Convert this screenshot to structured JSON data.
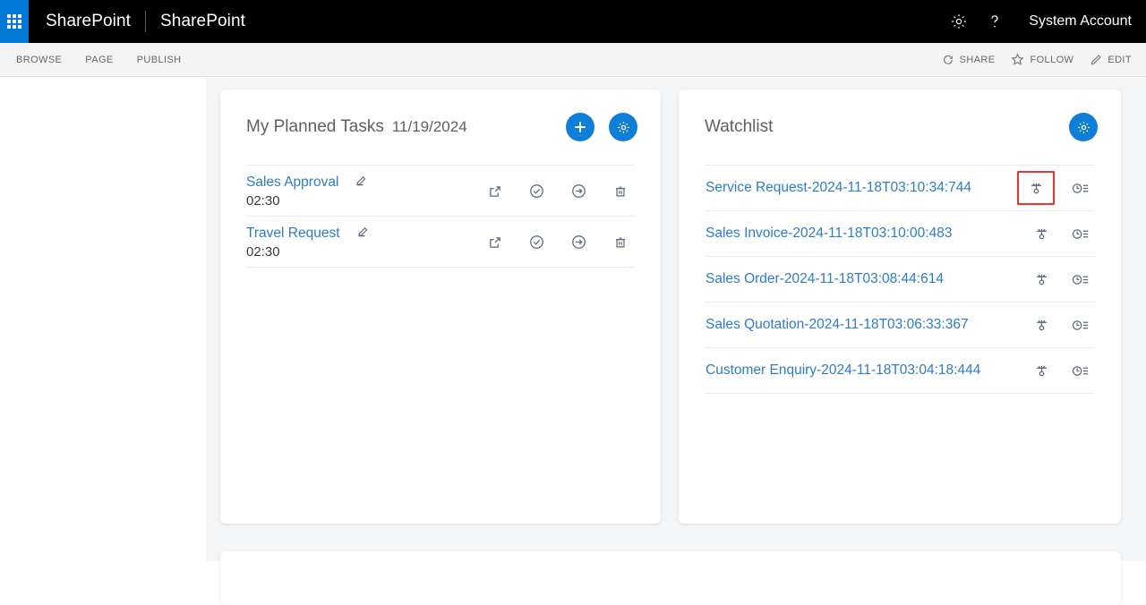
{
  "suite": {
    "app_launcher": "app-launcher",
    "brand": "SharePoint",
    "site": "SharePoint",
    "settings_icon": "gear-icon",
    "help_icon": "help-icon",
    "user": "System Account"
  },
  "ribbon": {
    "tabs": [
      {
        "label": "BROWSE"
      },
      {
        "label": "PAGE"
      },
      {
        "label": "PUBLISH"
      }
    ],
    "actions": [
      {
        "label": "SHARE",
        "icon": "share-icon"
      },
      {
        "label": "FOLLOW",
        "icon": "star-icon"
      },
      {
        "label": "EDIT",
        "icon": "pencil-icon"
      }
    ]
  },
  "tasks_card": {
    "title": "My Planned Tasks",
    "date": "11/19/2024",
    "add_button": "add-icon",
    "settings_button": "gear-icon",
    "rows": [
      {
        "name": "Sales Approval",
        "time": "02:30",
        "edit_icon": "pencil-icon",
        "actions": [
          "open-in-new-icon",
          "complete-icon",
          "forward-icon",
          "delete-icon"
        ]
      },
      {
        "name": "Travel Request",
        "time": "02:30",
        "edit_icon": "pencil-icon",
        "actions": [
          "open-in-new-icon",
          "complete-icon",
          "forward-icon",
          "delete-icon"
        ]
      }
    ]
  },
  "watchlist_card": {
    "title": "Watchlist",
    "settings_button": "gear-icon",
    "rows": [
      {
        "name": "Service Request-2024-11-18T03:10:34:744",
        "workflow_icon": "workflow-icon",
        "history_icon": "history-icon",
        "highlighted": true
      },
      {
        "name": "Sales Invoice-2024-11-18T03:10:00:483",
        "workflow_icon": "workflow-icon",
        "history_icon": "history-icon",
        "highlighted": false
      },
      {
        "name": "Sales Order-2024-11-18T03:08:44:614",
        "workflow_icon": "workflow-icon",
        "history_icon": "history-icon",
        "highlighted": false
      },
      {
        "name": "Sales Quotation-2024-11-18T03:06:33:367",
        "workflow_icon": "workflow-icon",
        "history_icon": "history-icon",
        "highlighted": false
      },
      {
        "name": "Customer Enquiry-2024-11-18T03:04:18:444",
        "workflow_icon": "workflow-icon",
        "history_icon": "history-icon",
        "highlighted": false
      }
    ]
  },
  "colors": {
    "accent_blue": "#0f7ed8",
    "link_blue": "#2b7cd3",
    "suite_black": "#000000",
    "launcher_blue": "#0078d7",
    "highlight_red": "#f23030",
    "canvas_gray": "#f4f5f7"
  }
}
